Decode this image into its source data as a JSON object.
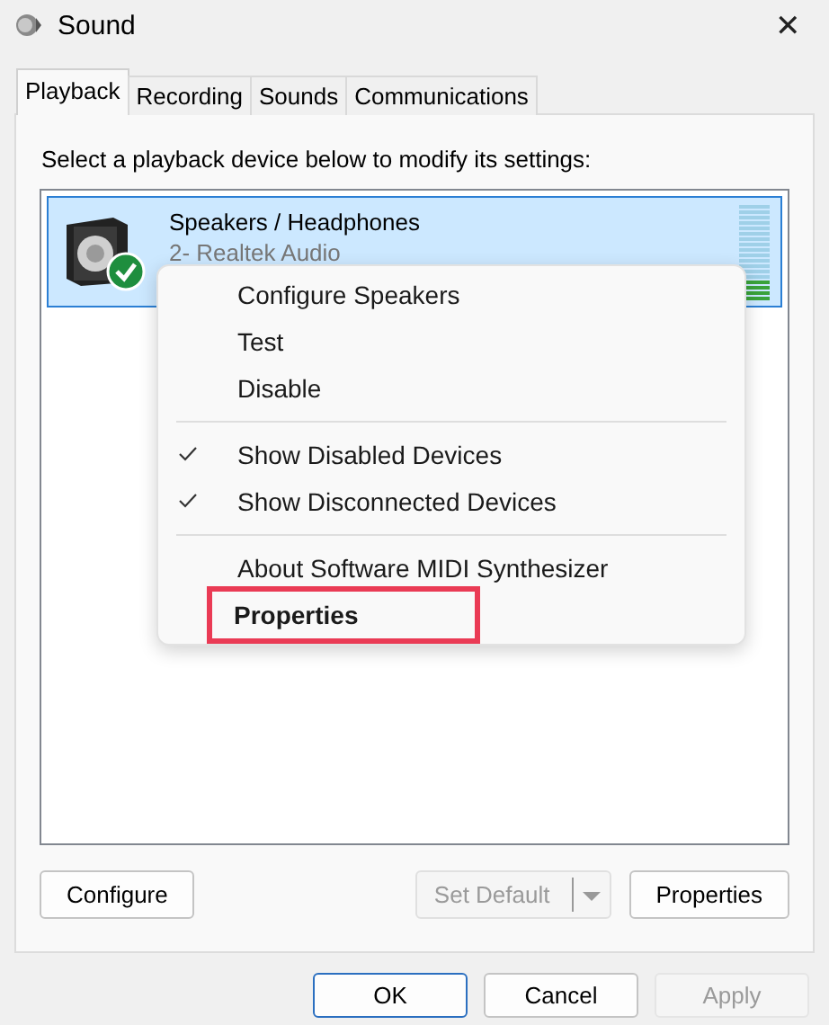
{
  "window": {
    "title": "Sound",
    "close": "✕"
  },
  "tabs": [
    {
      "label": "Playback",
      "selected": true
    },
    {
      "label": "Recording",
      "selected": false
    },
    {
      "label": "Sounds",
      "selected": false
    },
    {
      "label": "Communications",
      "selected": false
    }
  ],
  "instruction": "Select a playback device below to modify its settings:",
  "devices": [
    {
      "name": "Speakers / Headphones",
      "detail": "2- Realtek Audio",
      "selected": true,
      "is_default": true,
      "level": 0.2
    }
  ],
  "context_menu": {
    "groups": [
      [
        {
          "label": "Configure Speakers",
          "checked": false,
          "default": false,
          "highlighted": false
        },
        {
          "label": "Test",
          "checked": false,
          "default": false,
          "highlighted": false
        },
        {
          "label": "Disable",
          "checked": false,
          "default": false,
          "highlighted": false
        }
      ],
      [
        {
          "label": "Show Disabled Devices",
          "checked": true,
          "default": false,
          "highlighted": false
        },
        {
          "label": "Show Disconnected Devices",
          "checked": true,
          "default": false,
          "highlighted": false
        }
      ],
      [
        {
          "label": "About Software MIDI Synthesizer",
          "checked": false,
          "default": false,
          "highlighted": false
        },
        {
          "label": "Properties",
          "checked": false,
          "default": true,
          "highlighted": true
        }
      ]
    ]
  },
  "panel_buttons": [
    {
      "label": "Configure",
      "kind": "button",
      "disabled": false
    },
    {
      "label": "Set Default",
      "kind": "split",
      "disabled": true
    },
    {
      "label": "Properties",
      "kind": "button",
      "disabled": false
    }
  ],
  "dialog_buttons": [
    {
      "label": "OK",
      "disabled": false,
      "default": true
    },
    {
      "label": "Cancel",
      "disabled": false,
      "default": false
    },
    {
      "label": "Apply",
      "disabled": true,
      "default": false
    }
  ]
}
